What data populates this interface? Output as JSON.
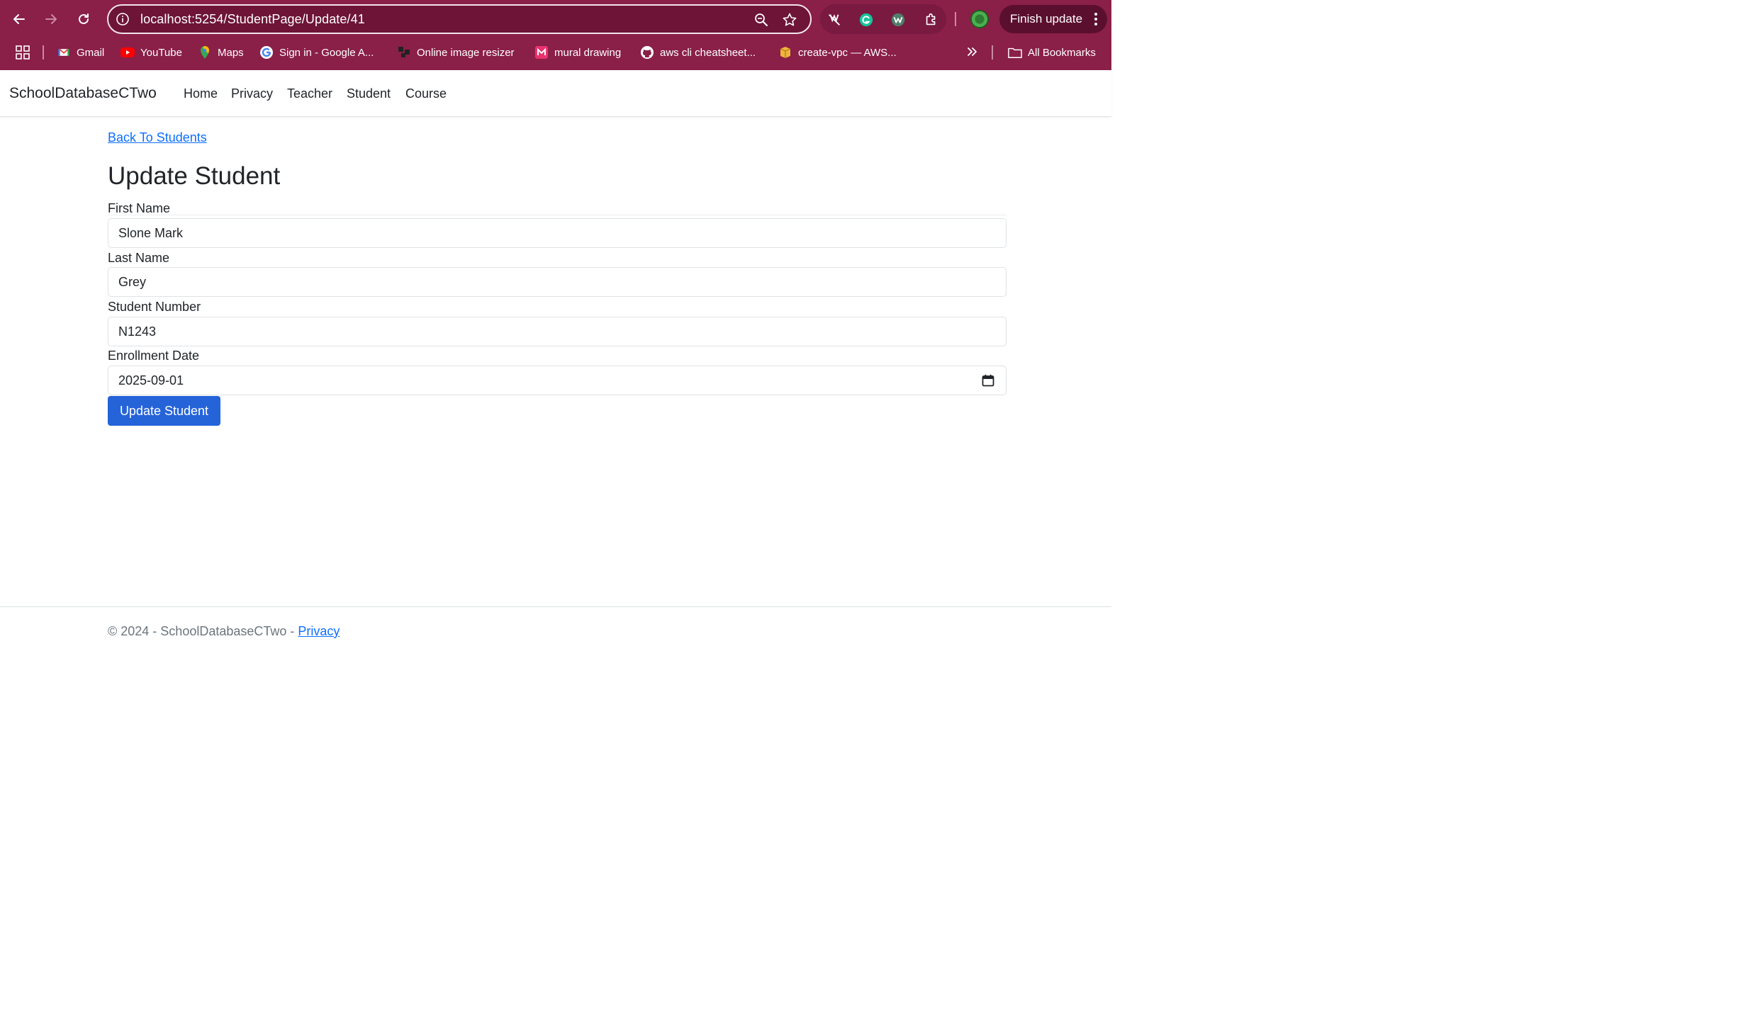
{
  "browser": {
    "url": "localhost:5254/StudentPage/Update/41",
    "finish_update_label": "Finish update",
    "bookmarks": [
      {
        "label": "Gmail",
        "icon": "gmail-icon"
      },
      {
        "label": "YouTube",
        "icon": "youtube-icon"
      },
      {
        "label": "Maps",
        "icon": "maps-icon"
      },
      {
        "label": "Sign in - Google A...",
        "icon": "google-icon"
      },
      {
        "label": "Online image resizer",
        "icon": "resizer-icon"
      },
      {
        "label": "mural drawing",
        "icon": "mural-icon"
      },
      {
        "label": "aws cli cheatsheet...",
        "icon": "github-icon"
      },
      {
        "label": "create-vpc — AWS...",
        "icon": "aws-icon"
      }
    ],
    "all_bookmarks_label": "All Bookmarks",
    "theme_color": "#8a1f48"
  },
  "navbar": {
    "brand": "SchoolDatabaseCTwo",
    "links": [
      "Home",
      "Privacy",
      "Teacher",
      "Student",
      "Course"
    ]
  },
  "main": {
    "back_link": "Back To Students",
    "title": "Update Student",
    "fields": {
      "first_name": {
        "label": "First Name",
        "value": "Slone Mark"
      },
      "last_name": {
        "label": "Last Name",
        "value": "Grey"
      },
      "student_number": {
        "label": "Student Number",
        "value": "N1243"
      },
      "enrollment_date": {
        "label": "Enrollment Date",
        "value": "2025-09-01"
      }
    },
    "submit_label": "Update Student",
    "primary_color": "#2563d9"
  },
  "footer": {
    "text": "© 2024 - SchoolDatabaseCTwo - ",
    "privacy_link": "Privacy"
  }
}
